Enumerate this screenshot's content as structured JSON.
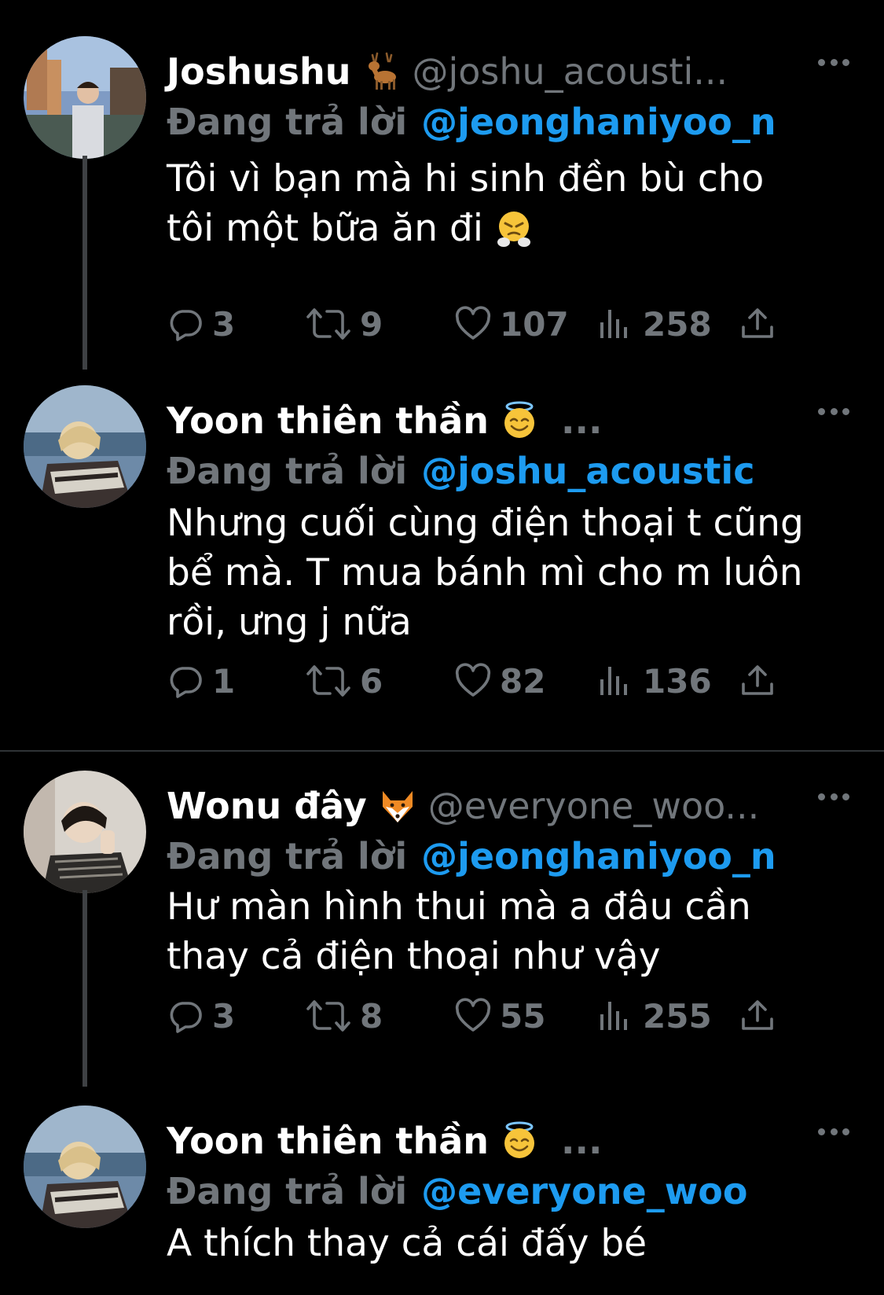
{
  "colors": {
    "background": "#000000",
    "text_primary": "#ffffff",
    "text_secondary": "#71767b",
    "link": "#1d9bf0",
    "thread_line": "#3e4144",
    "divider": "#2f3336"
  },
  "tweets": [
    {
      "display_name": "Joshushu",
      "name_emoji": "deer-emoji",
      "handle": "@joshu_acousti...",
      "reply_prefix": "Đang trả lời",
      "reply_to": "@jeonghaniyoo_n",
      "text_lines": [
        "Tôi vì bạn mà hi sinh đền bù cho",
        "tôi một bữa ăn đi"
      ],
      "text_emoji": "steam-from-nose-face-emoji",
      "replies": "3",
      "retweets": "9",
      "likes": "107",
      "views": "258"
    },
    {
      "display_name": "Yoon thiên thần",
      "name_emoji": "smiling-face-with-halo-emoji",
      "handle": "...",
      "reply_prefix": "Đang trả lời",
      "reply_to": "@joshu_acoustic",
      "text_lines": [
        "Nhưng cuối cùng điện thoại t cũng",
        "bể mà. T mua bánh mì cho m luôn",
        "rồi, ưng j nữa"
      ],
      "replies": "1",
      "retweets": "6",
      "likes": "82",
      "views": "136"
    },
    {
      "display_name": "Wonu đây",
      "name_emoji": "fox-emoji",
      "handle": "@everyone_woo...",
      "reply_prefix": "Đang trả lời",
      "reply_to": "@jeonghaniyoo_n",
      "text_lines": [
        "Hư màn hình thui mà a đâu cần",
        "thay cả điện thoại như vậy"
      ],
      "replies": "3",
      "retweets": "8",
      "likes": "55",
      "views": "255"
    },
    {
      "display_name": "Yoon thiên thần",
      "name_emoji": "smiling-face-with-halo-emoji",
      "handle": "...",
      "reply_prefix": "Đang trả lời",
      "reply_to": "@everyone_woo",
      "text_lines": [
        "A thích thay cả cái đấy bé"
      ]
    }
  ]
}
